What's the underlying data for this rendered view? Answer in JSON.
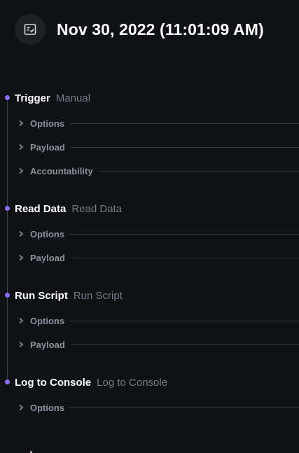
{
  "header": {
    "icon": "list-check-icon",
    "title": "Nov 30, 2022 (11:01:09 AM)"
  },
  "steps": [
    {
      "name": "Trigger",
      "type": "Manual",
      "children": [
        "Options",
        "Payload",
        "Accountability"
      ]
    },
    {
      "name": "Read Data",
      "type": "Read Data",
      "children": [
        "Options",
        "Payload"
      ]
    },
    {
      "name": "Run Script",
      "type": "Run Script",
      "children": [
        "Options",
        "Payload"
      ]
    },
    {
      "name": "Log to Console",
      "type": "Log to Console",
      "children": [
        "Options"
      ]
    }
  ],
  "colors": {
    "background": "#0f1115",
    "accent_dot": "#8b6cf6",
    "muted_text": "#747b87"
  }
}
